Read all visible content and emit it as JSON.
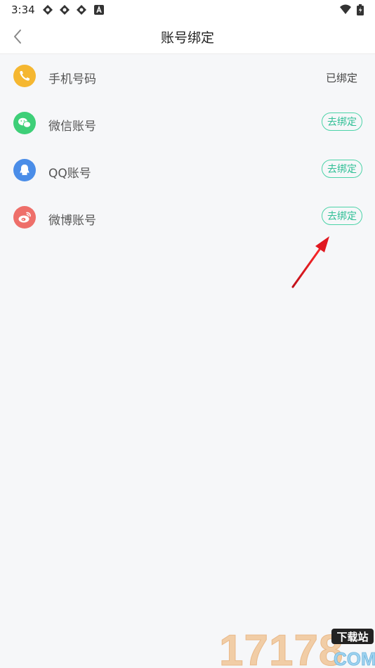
{
  "status_bar": {
    "time": "3:34"
  },
  "header": {
    "title": "账号绑定"
  },
  "accounts": [
    {
      "label": "手机号码",
      "status": "已绑定",
      "icon": "phone-icon",
      "color": "#f5b731"
    },
    {
      "label": "微信账号",
      "action": "去绑定",
      "icon": "wechat-icon",
      "color": "#3ecf78"
    },
    {
      "label": "QQ账号",
      "action": "去绑定",
      "icon": "qq-icon",
      "color": "#4a8de8"
    },
    {
      "label": "微博账号",
      "action": "去绑定",
      "icon": "weibo-icon",
      "color": "#ee6f6a"
    }
  ],
  "accent_color": "#4cd3a8",
  "watermark": {
    "main": "17178",
    "tag": "下载站",
    "suffix": "COM"
  }
}
